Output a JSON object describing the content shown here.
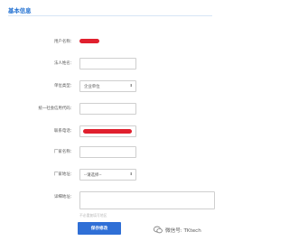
{
  "section": {
    "title": "基本信息"
  },
  "form": {
    "user_name_label": "用户名称：",
    "legal_person_label": "法人姓名：",
    "company_type_label": "单位类型：",
    "company_type_value": "企业单位",
    "credit_code_label": "统一社会信用代码：",
    "contact_phone_label": "联系电话：",
    "factory_name_label": "厂家名称：",
    "factory_address_label": "厂家地址：",
    "factory_address_value": "--请选择--",
    "detail_address_label": "详细地址：",
    "detail_address_hint": "不必重复填写地区"
  },
  "actions": {
    "save_label": "保存修改"
  },
  "watermark": {
    "text": "微信号: TKtech"
  },
  "colors": {
    "accent": "#2f6fd6",
    "title": "#1f6fd1",
    "redaction": "#e0202e"
  }
}
